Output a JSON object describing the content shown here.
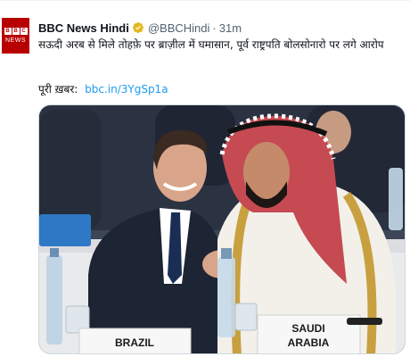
{
  "tweet": {
    "author_name": "BBC News Hindi",
    "handle": "@BBCHindi",
    "separator": "·",
    "time": "31m",
    "text": "सऊदी अरब से मिले तोहफ़े पर ब्राज़ील में घमासान, पूर्व राष्ट्रपति बोलसोनारो पर लगे आरोप",
    "read_more_label": "पूरी ख़बर:",
    "link": "bbc.in/3YgSp1a",
    "avatar_letters": [
      "B",
      "B",
      "C"
    ],
    "avatar_word": "NEWS"
  },
  "media": {
    "placard_left": "BRAZIL",
    "placard_right_line1": "SAUDI",
    "placard_right_line2": "ARABIA"
  },
  "colors": {
    "link": "#1d9bf0",
    "secondary_text": "#536471",
    "verified_gold": "#e2b719",
    "bbc_red": "#b80000"
  },
  "icons": {
    "verified": "gold-verified-badge-icon"
  }
}
